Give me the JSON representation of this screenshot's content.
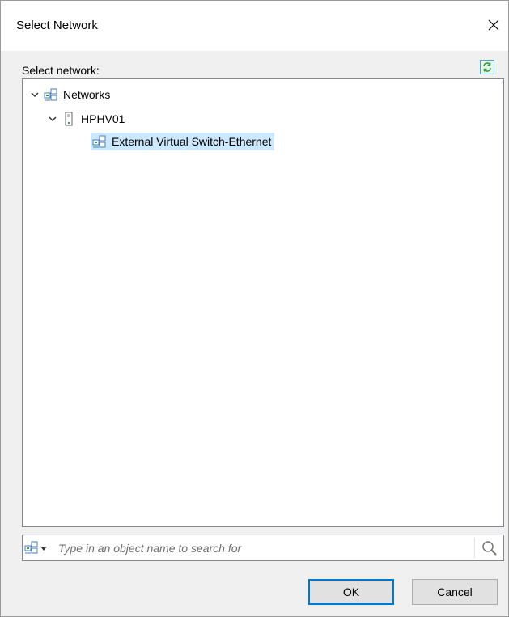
{
  "dialog": {
    "title": "Select Network",
    "close_icon": "close-icon"
  },
  "picker": {
    "label": "Select network:",
    "refresh_icon": "refresh-icon"
  },
  "tree": {
    "nodes": [
      {
        "label": "Networks",
        "expanded": true,
        "icon": "network-icon",
        "level": 0
      },
      {
        "label": "HPHV01",
        "expanded": true,
        "icon": "server-icon",
        "level": 1
      },
      {
        "label": "External Virtual Switch-Ethernet",
        "selected": true,
        "icon": "network-icon",
        "level": 2
      }
    ],
    "selection_color": "#cce8ff"
  },
  "search": {
    "placeholder": "Type in an object name to search for",
    "value": ""
  },
  "buttons": {
    "ok": "OK",
    "cancel": "Cancel"
  },
  "colors": {
    "accent": "#0078d7",
    "content_bg": "#f0f0f0"
  }
}
